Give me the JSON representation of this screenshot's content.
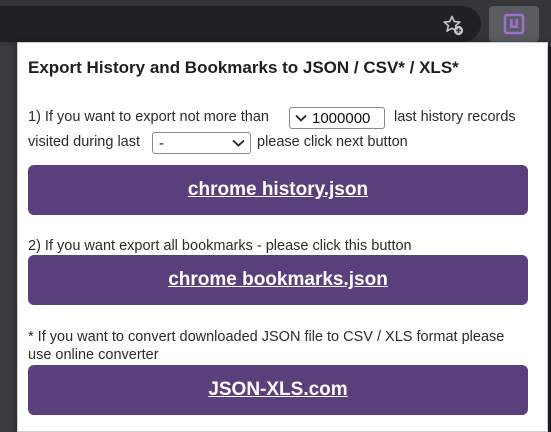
{
  "popup": {
    "title": "Export History and Bookmarks to JSON / CSV* / XLS*",
    "history": {
      "line1_prefix": "1) If you want to export not more than",
      "max_records_value": "1000000",
      "line1_suffix": "last history records",
      "line2_prefix": "visited during last",
      "period_selected": "-",
      "line2_suffix": "please click next button",
      "button_label": "chrome history.json"
    },
    "bookmarks": {
      "text": "2) If you want export all bookmarks - please click this button",
      "button_label": "chrome bookmarks.json"
    },
    "converter": {
      "line1": "* If you want to convert downloaded JSON file to CSV / XLS format please",
      "line2": "use online converter",
      "button_label": "JSON-XLS.com"
    }
  },
  "colors": {
    "button_bg": "#5a3f7d",
    "toolbar_bg": "#35363a",
    "extension_icon": "#9b6fd3"
  },
  "icons": {
    "bookmark": "star-add-icon",
    "extension": "extension-logo-icon",
    "stepper": "chevron-down-icon",
    "select": "chevron-down-icon"
  }
}
